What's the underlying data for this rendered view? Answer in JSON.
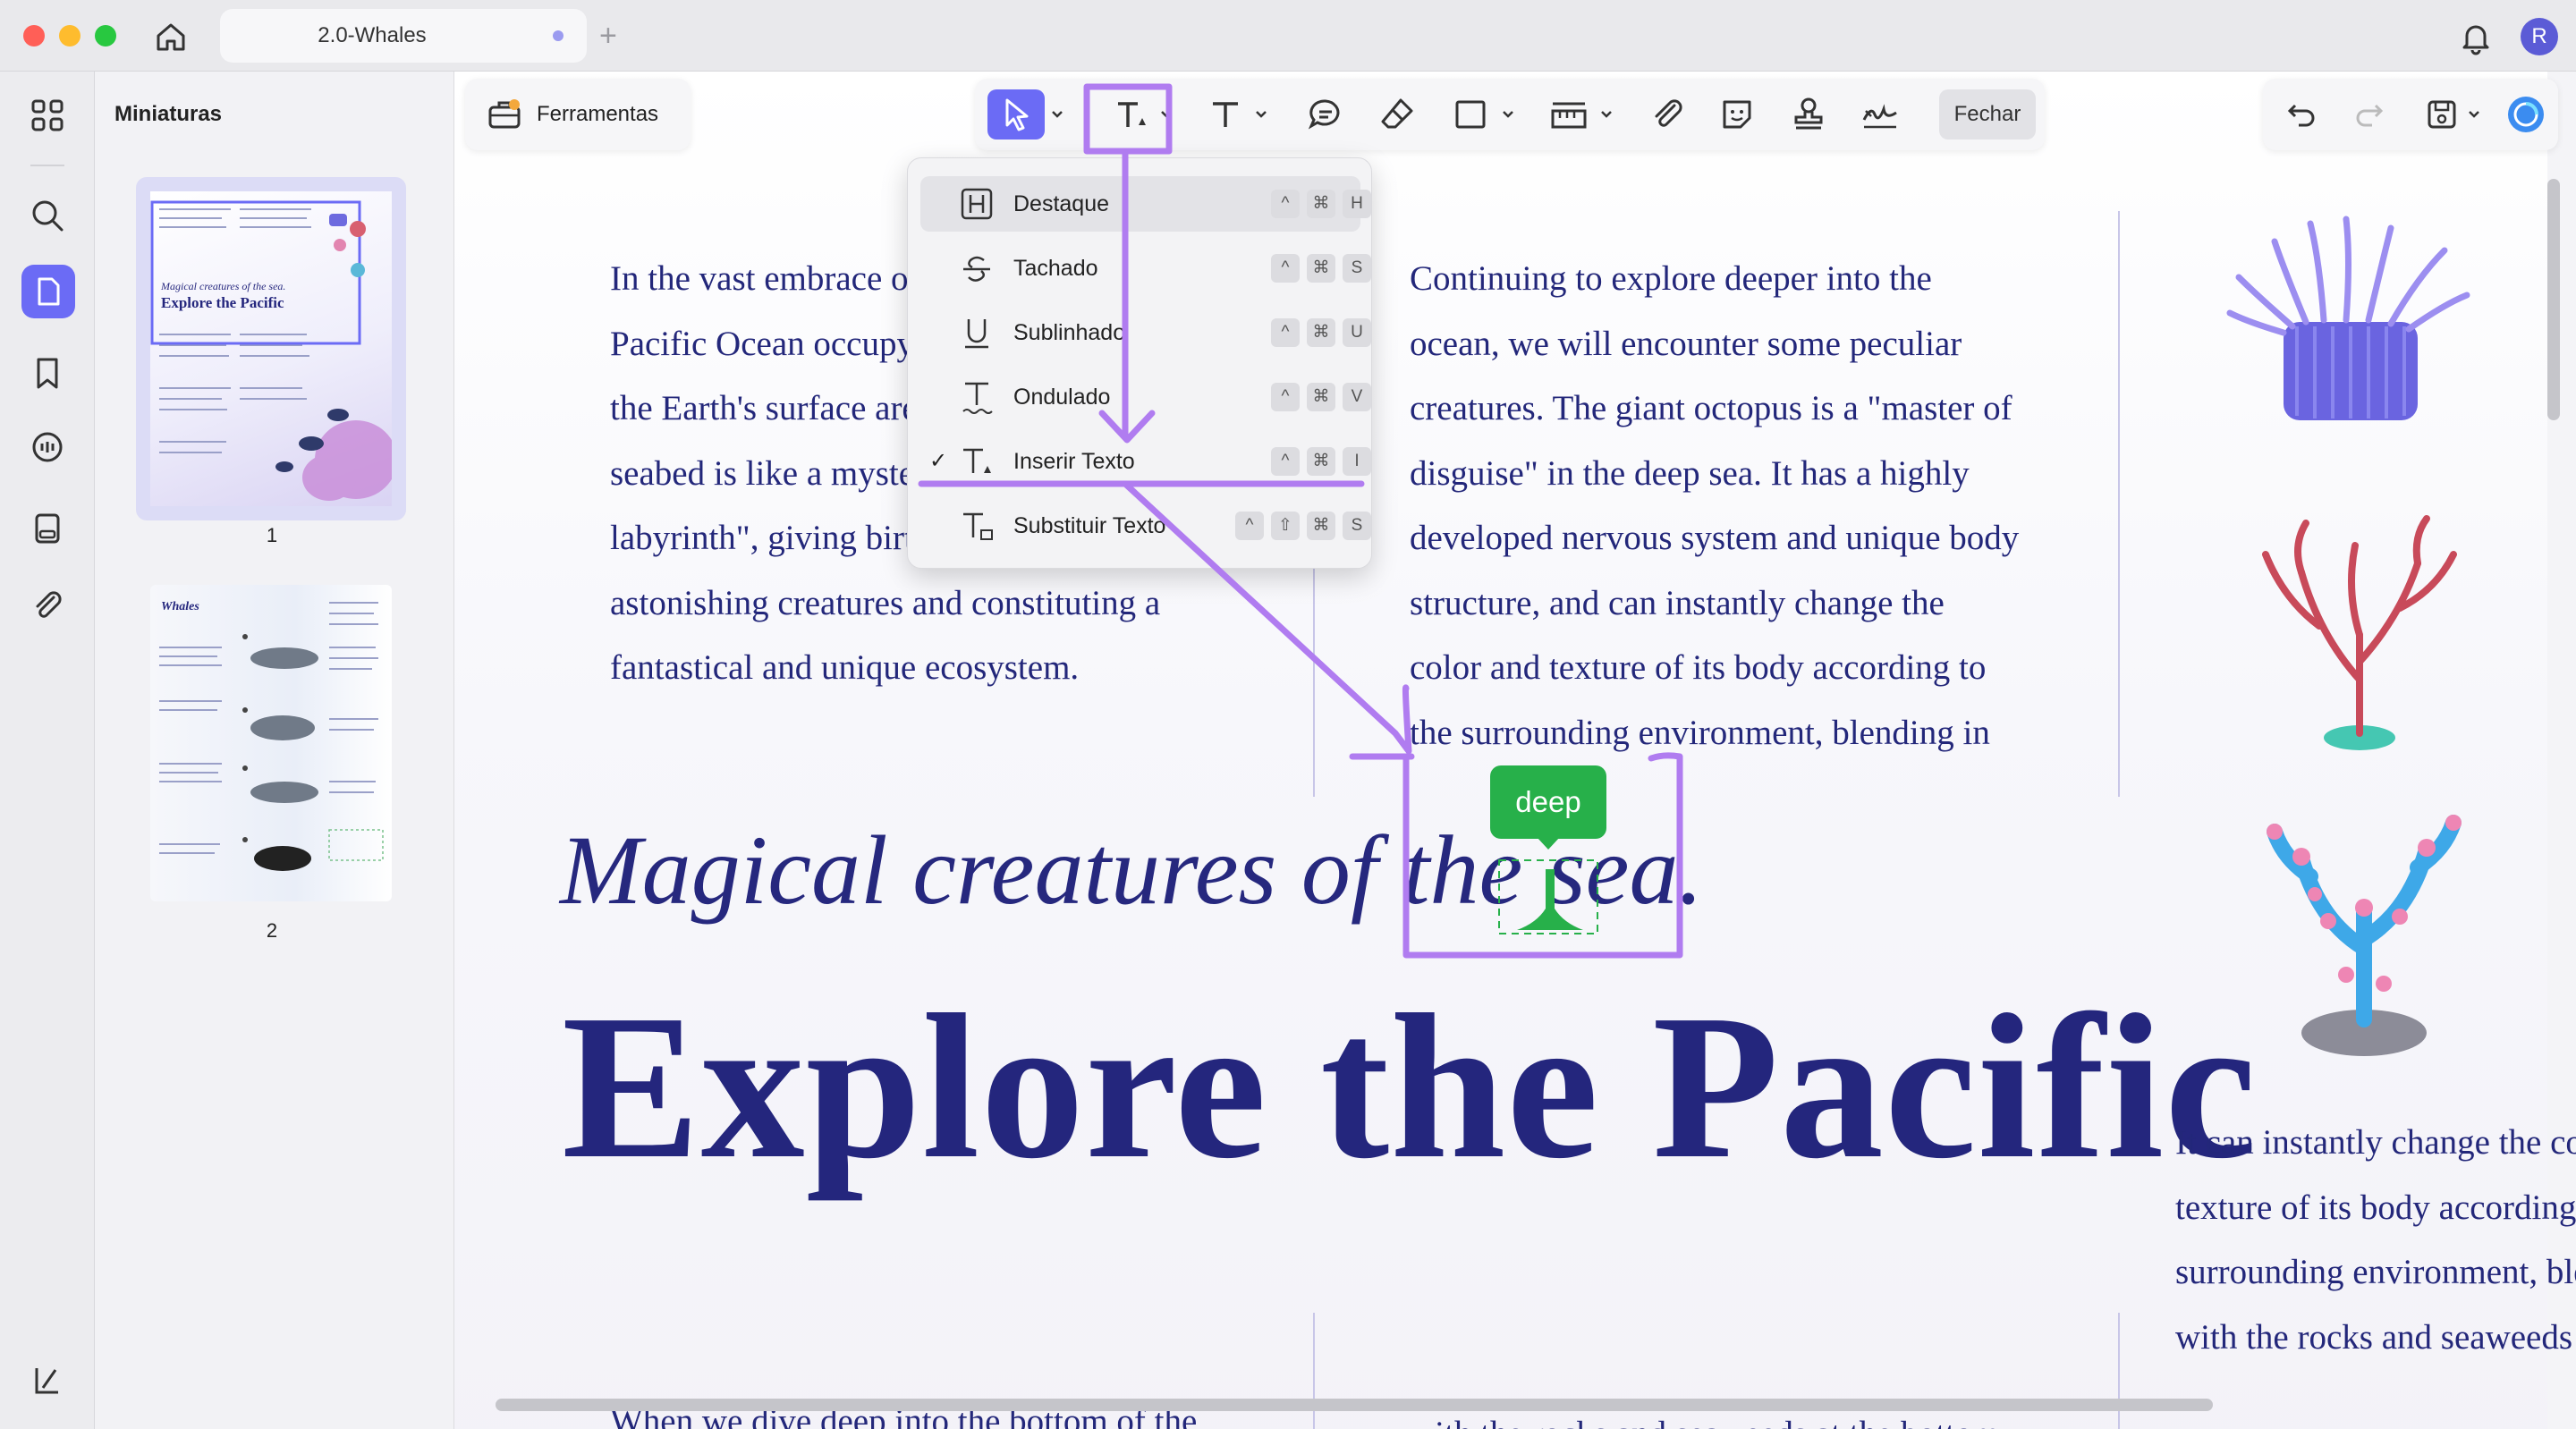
{
  "window": {
    "tab_title": "2.0-Whales",
    "add_tab": "+",
    "avatar_initial": "R"
  },
  "sidebar": {
    "panel_title": "Miniaturas",
    "thumbnails": [
      {
        "page": "1",
        "title": "Explore the Pacific",
        "subtitle": "Magical creatures of the sea."
      },
      {
        "page": "2",
        "title": "Whales"
      }
    ]
  },
  "toolbar": {
    "tools_label": "Ferramentas",
    "close_label": "Fechar"
  },
  "markup_menu": {
    "items": [
      {
        "label": "Destaque",
        "shortcut": [
          "^",
          "⌘",
          "H"
        ],
        "selected": false
      },
      {
        "label": "Tachado",
        "shortcut": [
          "^",
          "⌘",
          "S"
        ],
        "selected": false
      },
      {
        "label": "Sublinhado",
        "shortcut": [
          "^",
          "⌘",
          "U"
        ],
        "selected": false
      },
      {
        "label": "Ondulado",
        "shortcut": [
          "^",
          "⌘",
          "V"
        ],
        "selected": false
      },
      {
        "label": "Inserir Texto",
        "shortcut": [
          "^",
          "⌘",
          "I"
        ],
        "selected": true,
        "check": "✓"
      },
      {
        "label": "Substituir Texto",
        "shortcut": [
          "^",
          "⇧",
          "⌘",
          "S"
        ],
        "selected": false
      }
    ]
  },
  "document": {
    "col1_lines": [
      "In the vast embrace of the",
      "Pacific Ocean occupying",
      "the Earth's surface area, the",
      "seabed is like a mysterious",
      "labyrinth\", giving birth to",
      "astonishing creatures and constituting a",
      "fantastical and unique ecosystem."
    ],
    "col2_lines": [
      "Continuing to explore deeper into the",
      "ocean, we will encounter some peculiar",
      "creatures. The giant octopus is a \"master of",
      "disguise\" in the deep sea. It has a highly",
      "developed nervous system and unique body",
      "structure, and can instantly change the",
      "color and texture of its body according to",
      "the surrounding environment, blending in"
    ],
    "subtitle": "Magical creatures of the sea.",
    "headline": "Explore the Pacific",
    "col3_lines": [
      "It can instantly change the color and",
      "texture of its body according to the",
      "surrounding environment, blending in",
      "with the rocks and seaweeds"
    ],
    "bottom_col1": "When we dive deep into the bottom of the",
    "bottom_col2": "with the rocks and seaweeds at the bottom"
  },
  "annotation": {
    "inserted_text": "deep",
    "accent_color": "#b07cf0",
    "insert_color": "#27b04a"
  },
  "colors": {
    "brand": "#6b6bf5",
    "text_navy": "#23277a"
  }
}
